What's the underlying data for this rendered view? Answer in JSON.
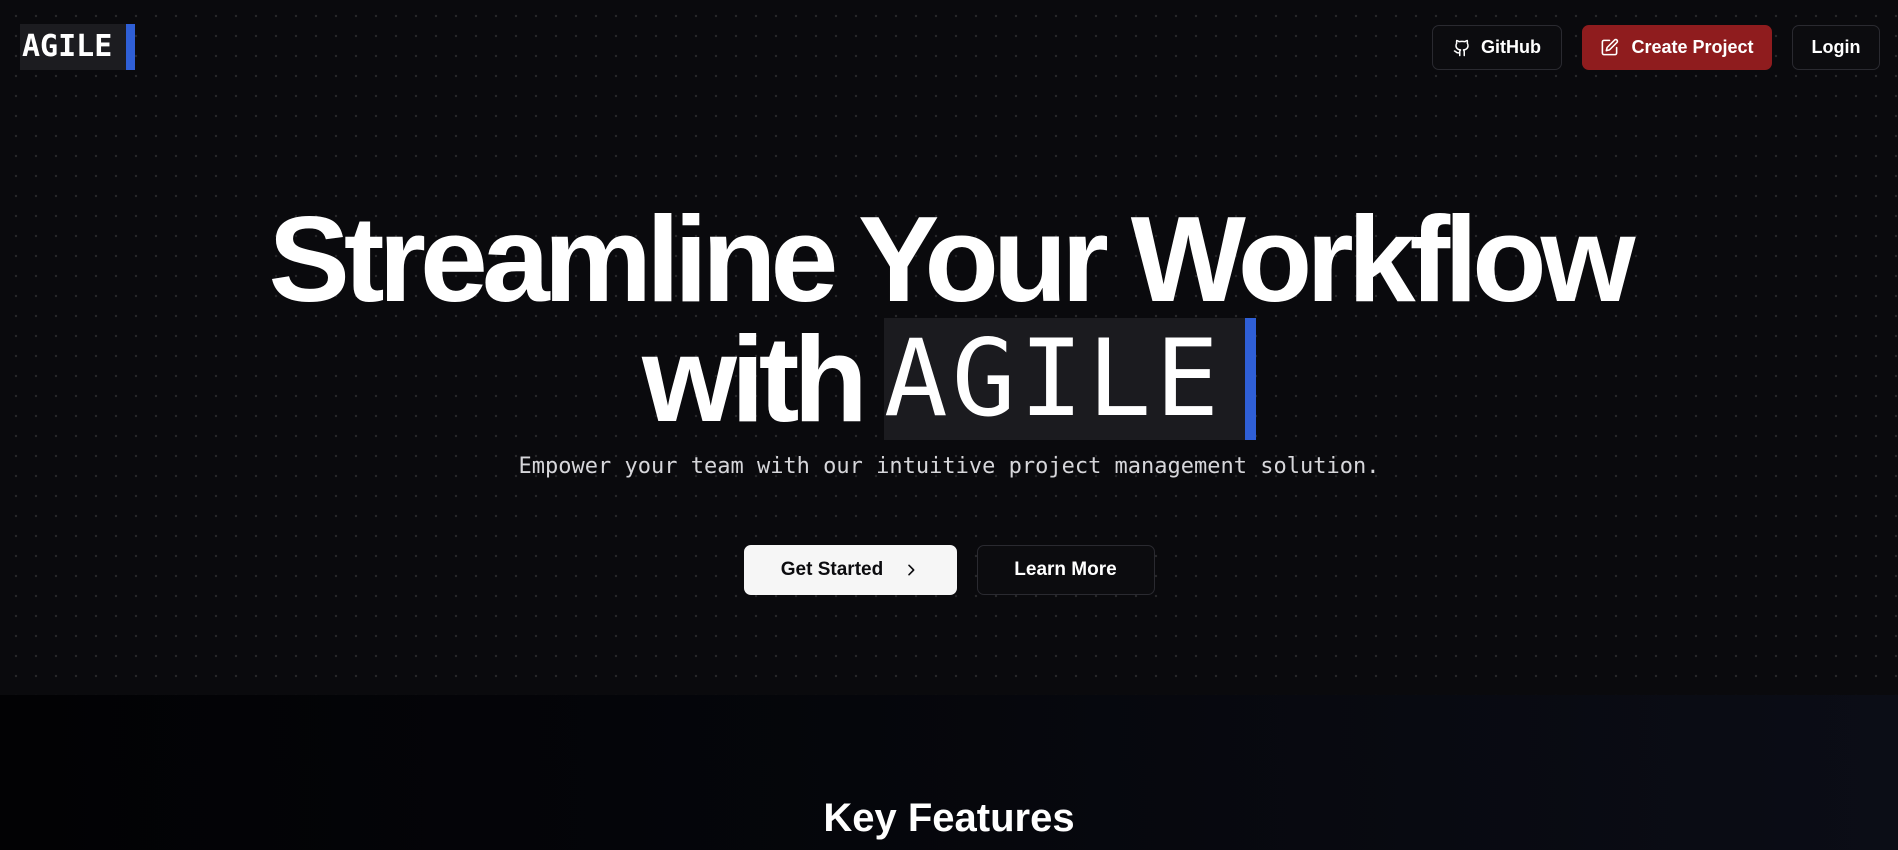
{
  "header": {
    "logo_text": "AGILE",
    "nav": {
      "github_label": "GitHub",
      "create_project_label": "Create Project",
      "login_label": "Login"
    }
  },
  "hero": {
    "title_line1": "Streamline Your Workflow",
    "title_with": "with",
    "title_brand": "AGILE",
    "subtitle": "Empower your team with our intuitive project management solution.",
    "primary_cta": "Get Started",
    "secondary_cta": "Learn More"
  },
  "features": {
    "heading": "Key Features"
  },
  "colors": {
    "accent_blue": "#2f5fd6",
    "create_button_red": "#8f1c1e",
    "background": "#0a0a0d"
  },
  "icons": {
    "github": "github-icon",
    "create": "edit-square-icon",
    "get_started": "chevron-right-icon"
  }
}
